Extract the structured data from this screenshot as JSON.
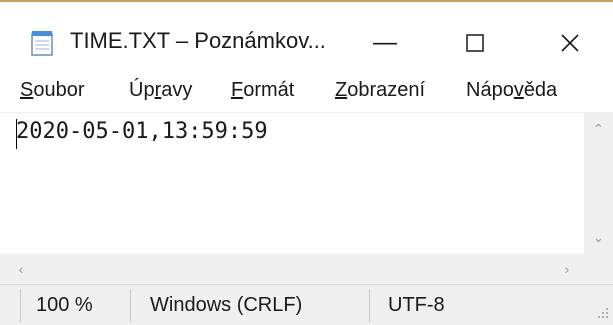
{
  "window": {
    "title": "TIME.TXT – Poznámkov...",
    "minimize_glyph": "—",
    "maximize_glyph": "☐",
    "close_glyph": "✕",
    "icon": "notepad-icon"
  },
  "menu": {
    "items": [
      {
        "pre": "",
        "key": "S",
        "post": "oubor"
      },
      {
        "pre": "Úp",
        "key": "r",
        "post": "avy"
      },
      {
        "pre": "",
        "key": "F",
        "post": "ormát"
      },
      {
        "pre": "",
        "key": "Z",
        "post": "obrazení"
      },
      {
        "pre": "Nápo",
        "key": "v",
        "post": "ěda"
      }
    ]
  },
  "editor": {
    "content": "2020-05-01,13:59:59"
  },
  "scrollbars": {
    "up_arrow": "⌃",
    "down_arrow": "⌄",
    "left_arrow": "‹",
    "right_arrow": "›"
  },
  "status": {
    "zoom": "100 %",
    "line_ending": "Windows (CRLF)",
    "encoding": "UTF-8"
  }
}
